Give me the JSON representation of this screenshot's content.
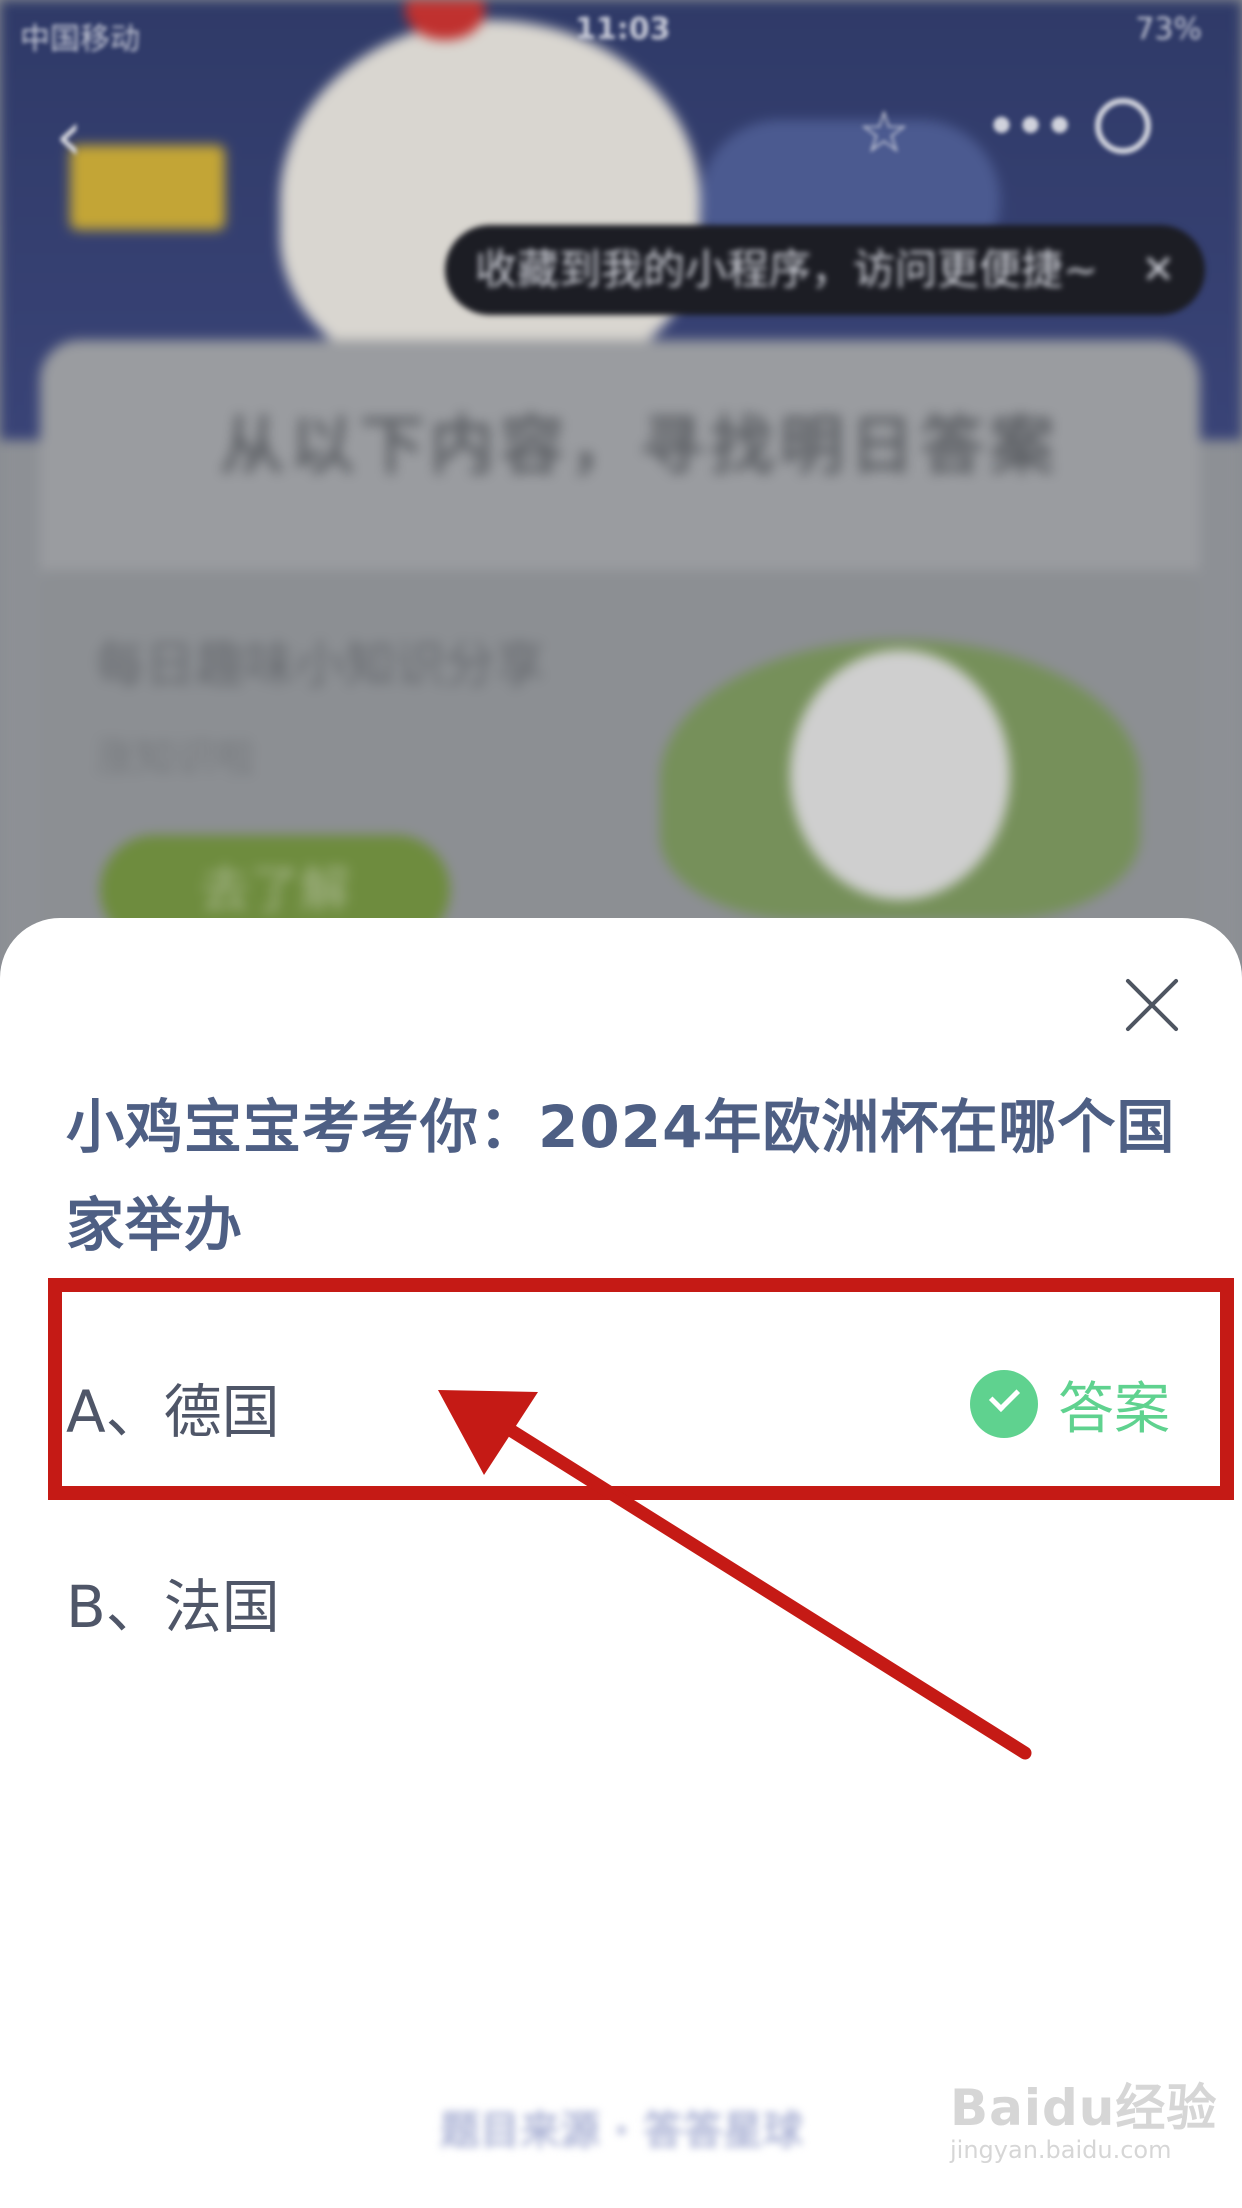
{
  "status_bar": {
    "carrier": "中国移动",
    "time": "11:03",
    "battery": "73%"
  },
  "background": {
    "toast_text": "收藏到我的小程序，访问更便捷~",
    "section_title": "从以下内容，寻找明日答案",
    "card_title": "每日趣味小知识分享",
    "card_subtitle": "涨知识啦",
    "card_button": "去了解"
  },
  "quiz": {
    "question": "小鸡宝宝考考你：2024年欧洲杯在哪个国家举办",
    "options": [
      {
        "label": "A、德国"
      },
      {
        "label": "B、法国"
      }
    ],
    "answer_label": "答案"
  },
  "footer": {
    "text": "题目来源 · 答答星球"
  },
  "watermark": {
    "main": "Baidu经验",
    "sub": "jingyan.baidu.com"
  },
  "colors": {
    "accent_green": "#5fd28f",
    "question_text": "#4e5f84",
    "annotation_red": "#c51a15"
  }
}
